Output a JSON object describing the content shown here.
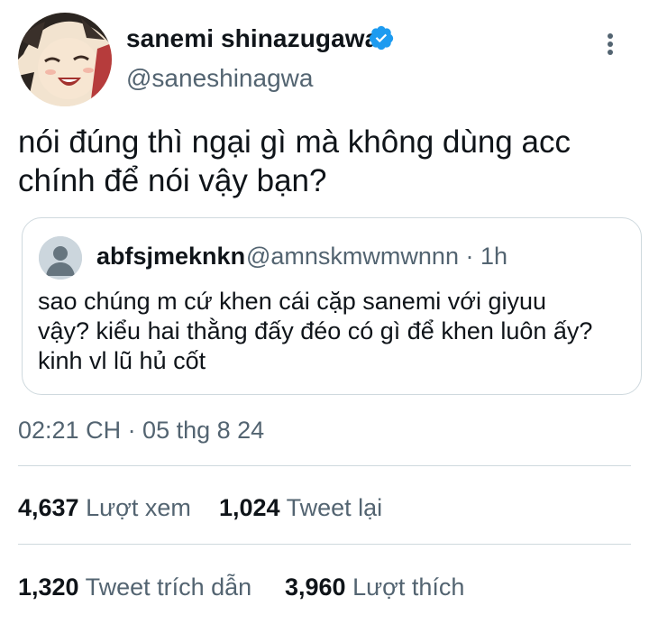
{
  "author": {
    "display_name": "sanemi shinazugawa",
    "handle": "@saneshinagwa",
    "verified_icon": "verified-badge-icon",
    "verified_color": "#1d9bf0"
  },
  "tweet": {
    "text_lines": [
      "nói đúng thì ngại gì mà không dùng acc",
      "chính để nói vậy bạn?"
    ],
    "timestamp": "02:21 CH · 05 thg 8 24"
  },
  "quoted_tweet": {
    "name": "abfsjmeknkn",
    "meta": "@amnskmwmwnnn · 1h",
    "text_lines": [
      "sao chúng m cứ khen cái cặp sanemi với giyuu",
      "vậy? kiểu hai thằng đấy đéo có gì để khen luôn ấy?",
      "kinh vl lũ hủ cốt"
    ]
  },
  "stats": [
    {
      "value": "4,637",
      "label": "Lượt xem"
    },
    {
      "value": "1,024",
      "label": "Tweet lại"
    },
    {
      "value": "1,320",
      "label": "Tweet trích dẫn"
    },
    {
      "value": "3,960",
      "label": "Lượt thích"
    }
  ],
  "colors": {
    "text": "#0f1419",
    "secondary": "#536471",
    "border": "#cfd9de"
  }
}
